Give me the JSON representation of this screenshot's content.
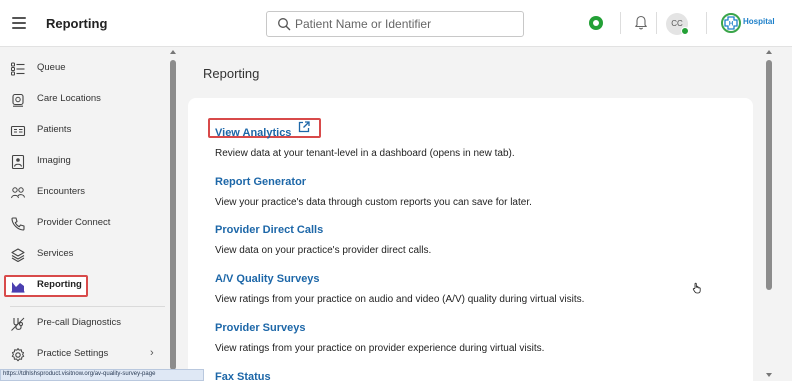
{
  "header": {
    "title": "Reporting",
    "search_placeholder": "Patient Name or Identifier",
    "avatar_initials": "CC",
    "logo_text": "Hospital"
  },
  "sidebar": {
    "items": [
      {
        "label": "Queue",
        "icon": "queue-list-icon"
      },
      {
        "label": "Care Locations",
        "icon": "care-locations-icon"
      },
      {
        "label": "Patients",
        "icon": "patient-card-icon"
      },
      {
        "label": "Imaging",
        "icon": "imaging-icon"
      },
      {
        "label": "Encounters",
        "icon": "encounters-icon"
      },
      {
        "label": "Provider Connect",
        "icon": "phone-icon"
      },
      {
        "label": "Services",
        "icon": "services-layers-icon"
      },
      {
        "label": "Reporting",
        "icon": "reporting-chart-icon",
        "active": true
      },
      {
        "label": "Pre-call Diagnostics",
        "icon": "stethoscope-icon"
      },
      {
        "label": "Practice Settings",
        "icon": "gear-icon",
        "has_chevron": true
      }
    ]
  },
  "main": {
    "title": "Reporting",
    "sections": [
      {
        "link": "View Analytics",
        "desc": "Review data at your tenant-level in a dashboard (opens in new tab)."
      },
      {
        "link": "Report Generator",
        "desc": "View your practice's data through custom reports you can save for later."
      },
      {
        "link": "Provider Direct Calls",
        "desc": "View data on your practice's provider direct calls."
      },
      {
        "link": "A/V Quality Surveys",
        "desc": "View ratings from your practice on audio and video (A/V) quality during virtual visits."
      },
      {
        "link": "Provider Surveys",
        "desc": "View ratings from your practice on provider experience during virtual visits."
      },
      {
        "link": "Fax Status",
        "desc": ""
      }
    ]
  },
  "status_bar": {
    "url": "https://tdhlshsproduct.visitnow.org/av-quality-survey-page"
  },
  "colors": {
    "accent_link": "#1d67a8",
    "highlight": "#d84a4a",
    "status_green": "#23a036"
  }
}
